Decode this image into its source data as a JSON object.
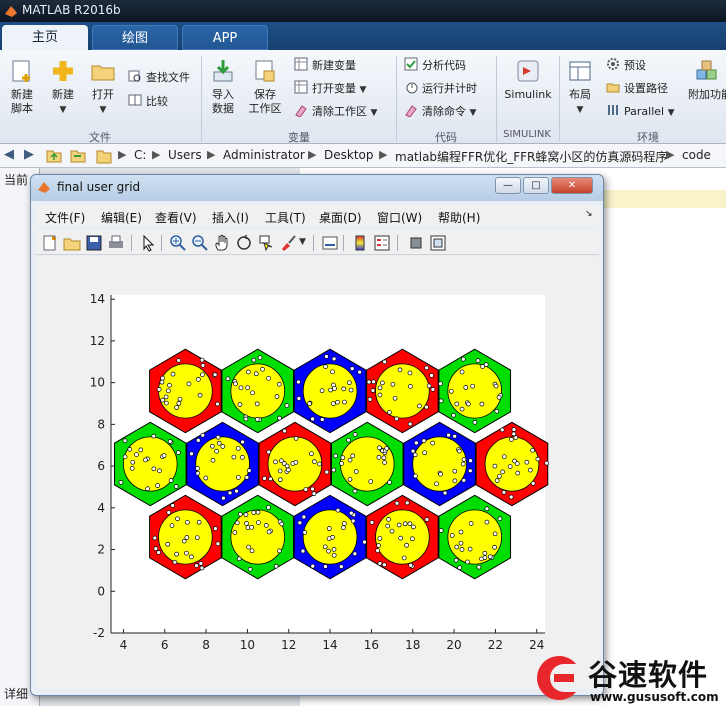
{
  "app": {
    "title": "MATLAB R2016b"
  },
  "tabs": [
    {
      "label": "主页",
      "active": true
    },
    {
      "label": "绘图",
      "active": false
    },
    {
      "label": "APP",
      "active": false
    }
  ],
  "ribbon": {
    "file": {
      "section_label": "文件",
      "new_script": "新建\n脚本",
      "new": "新建",
      "open": "打开",
      "find_files": "查找文件",
      "compare": "比较"
    },
    "variable": {
      "section_label": "变量",
      "import_data": "导入\n数据",
      "save_workspace": "保存\n工作区",
      "new_variable": "新建变量",
      "open_variable": "打开变量",
      "clear_workspace": "清除工作区"
    },
    "code": {
      "section_label": "代码",
      "analyze_code": "分析代码",
      "run_and_time": "运行并计时",
      "clear_commands": "清除命令"
    },
    "simulink": {
      "section_label": "SIMULINK",
      "simulink": "Simulink"
    },
    "environment": {
      "section_label": "环境",
      "layout": "布局",
      "preferences": "预设",
      "set_path": "设置路径",
      "parallel": "Parallel",
      "add_ons": "附加功能"
    }
  },
  "path": {
    "crumbs": [
      "C:",
      "Users",
      "Administrator",
      "Desktop",
      "matlab编程FFR优化_FFR蜂窝小区的仿真源码程序",
      "code"
    ]
  },
  "panels": {
    "current_folder": "当前",
    "details": "详细"
  },
  "figure": {
    "title": "final user grid",
    "menu": [
      "文件(F)",
      "编辑(E)",
      "查看(V)",
      "插入(I)",
      "工具(T)",
      "桌面(D)",
      "窗口(W)",
      "帮助(H)"
    ],
    "window_buttons": {
      "minimize": "—",
      "maximize": "□",
      "close": "✕"
    }
  },
  "chart_data": {
    "type": "scatter",
    "title": "",
    "xlabel": "",
    "ylabel": "",
    "xlim": [
      3.4,
      24.4
    ],
    "ylim": [
      -2,
      14.2
    ],
    "xticks": [
      4,
      6,
      8,
      10,
      12,
      14,
      16,
      18,
      20,
      22,
      24
    ],
    "yticks": [
      -2,
      0,
      2,
      4,
      6,
      8,
      10,
      12,
      14
    ],
    "grid": false,
    "hex_radius": 2.0,
    "inner_circle_radius": 1.3,
    "inner_circle_color": "#ffff00",
    "cells": [
      {
        "x": 7.0,
        "y": 9.6,
        "color": "#ff0000"
      },
      {
        "x": 10.5,
        "y": 9.6,
        "color": "#00dd00"
      },
      {
        "x": 14.0,
        "y": 9.6,
        "color": "#0000ff"
      },
      {
        "x": 17.5,
        "y": 9.6,
        "color": "#ff0000"
      },
      {
        "x": 21.0,
        "y": 9.6,
        "color": "#00dd00"
      },
      {
        "x": 5.3,
        "y": 6.1,
        "color": "#00dd00"
      },
      {
        "x": 8.8,
        "y": 6.1,
        "color": "#0000ff"
      },
      {
        "x": 12.3,
        "y": 6.1,
        "color": "#ff0000"
      },
      {
        "x": 15.8,
        "y": 6.1,
        "color": "#00dd00"
      },
      {
        "x": 19.3,
        "y": 6.1,
        "color": "#0000ff"
      },
      {
        "x": 22.8,
        "y": 6.1,
        "color": "#ff0000"
      },
      {
        "x": 7.0,
        "y": 2.6,
        "color": "#ff0000"
      },
      {
        "x": 10.5,
        "y": 2.6,
        "color": "#00dd00"
      },
      {
        "x": 14.0,
        "y": 2.6,
        "color": "#0000ff"
      },
      {
        "x": 17.5,
        "y": 2.6,
        "color": "#ff0000"
      },
      {
        "x": 21.0,
        "y": 2.6,
        "color": "#00dd00"
      }
    ],
    "users_per_cell": 22
  },
  "watermark": {
    "text": "谷速软件",
    "url": "www.gususoft.com",
    "color": "#e8272d"
  }
}
